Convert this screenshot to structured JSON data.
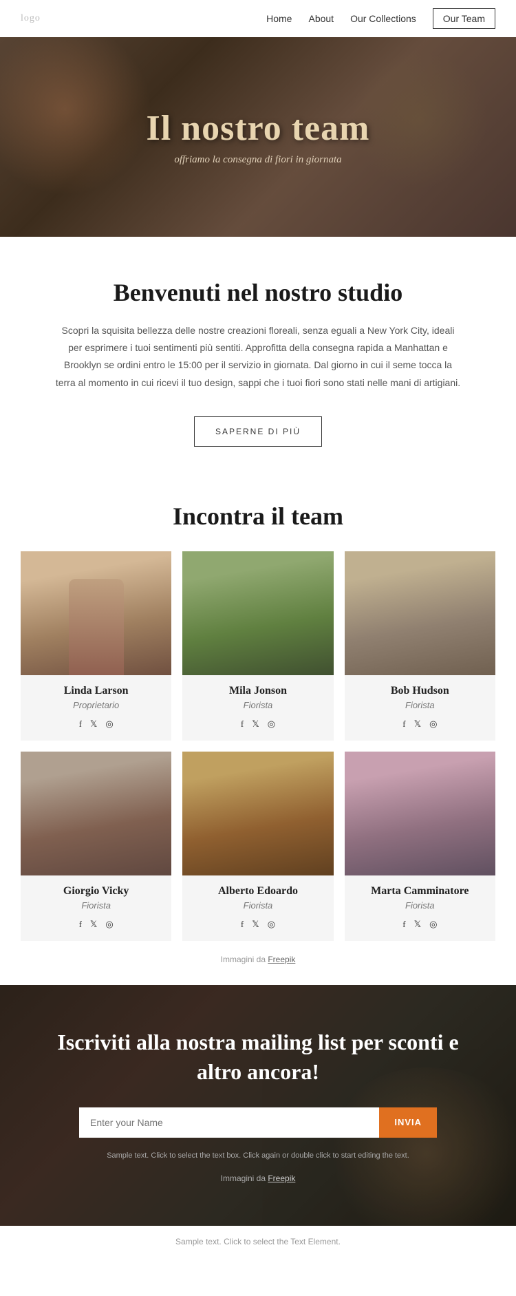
{
  "nav": {
    "logo": "logo",
    "links": [
      {
        "label": "Home",
        "active": false
      },
      {
        "label": "About",
        "active": false
      },
      {
        "label": "Our Collections",
        "active": false
      },
      {
        "label": "Our Team",
        "active": true
      }
    ]
  },
  "hero": {
    "title": "Il nostro team",
    "subtitle": "offriamo la consegna di fiori in giornata"
  },
  "welcome": {
    "title": "Benvenuti nel nostro studio",
    "body": "Scopri la squisita bellezza delle nostre creazioni floreali, senza eguali a New York City, ideali per esprimere i tuoi sentimenti più sentiti. Approfitta della consegna rapida a Manhattan e Brooklyn se ordini entro le 15:00 per il servizio in giornata. Dal giorno in cui il seme tocca la terra al momento in cui ricevi il tuo design, sappi che i tuoi fiori sono stati nelle mani di artigiani.",
    "button": "SAPERNE DI PIÙ"
  },
  "team": {
    "title": "Incontra il team",
    "members": [
      {
        "name": "Linda Larson",
        "role": "Proprietario",
        "photo_class": "pa-linda"
      },
      {
        "name": "Mila Jonson",
        "role": "Fiorista",
        "photo_class": "pa-mila"
      },
      {
        "name": "Bob Hudson",
        "role": "Fiorista",
        "photo_class": "pa-bob"
      },
      {
        "name": "Giorgio Vicky",
        "role": "Fiorista",
        "photo_class": "pa-giorgio"
      },
      {
        "name": "Alberto Edoardo",
        "role": "Fiorista",
        "photo_class": "pa-alberto"
      },
      {
        "name": "Marta Camminatore",
        "role": "Fiorista",
        "photo_class": "pa-marta"
      }
    ],
    "freepik_prefix": "Immagini da ",
    "freepik_link": "Freepik"
  },
  "mailing": {
    "title": "Iscriviti alla nostra mailing list per sconti e altro ancora!",
    "input_placeholder": "Enter your Name",
    "button_label": "INVIA",
    "sample_text": "Sample text. Click to select the text box. Click again or double click to start editing the text.",
    "freepik_prefix": "Immagini da ",
    "freepik_link": "Freepik"
  },
  "footer": {
    "sample_text": "Sample text. Click to select the Text Element."
  },
  "social": {
    "facebook": "f",
    "twitter": "𝕏",
    "instagram": "◎"
  }
}
